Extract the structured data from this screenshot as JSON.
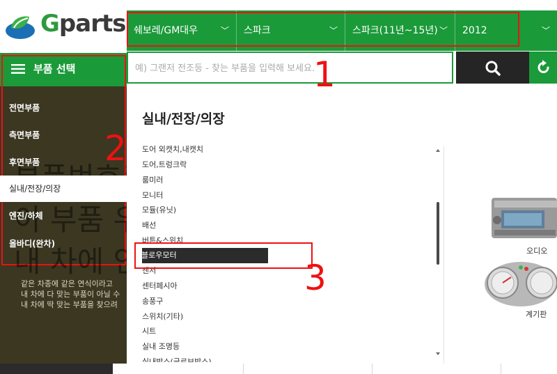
{
  "logo": {
    "brand_g": "G",
    "brand_rest": "parts"
  },
  "vehicle_selector": {
    "maker": "쉐보레/GM대우",
    "model": "스파크",
    "generation": "스파크(11년~15년)",
    "year": "2012"
  },
  "sidebar": {
    "header_label": "부품 선택",
    "categories": [
      {
        "label": "전면부품",
        "active": false
      },
      {
        "label": "측면부품",
        "active": false
      },
      {
        "label": "후면부품",
        "active": false
      },
      {
        "label": "실내/전장/의장",
        "active": true
      },
      {
        "label": "엔진/하체",
        "active": false
      },
      {
        "label": "올바디(완차)",
        "active": false
      }
    ],
    "background_text": [
      "부품번호로 검",
      "이 부품 우",
      "내 차에 안"
    ],
    "description": [
      "같은 차종에 같은 연식이라고",
      "내 차에 다 맞는 부품이 아닐 수",
      "내 차에 딱 맞는 부품을 찾으려"
    ]
  },
  "search": {
    "placeholder": "예) 그랜저 전조등 - 찾는 부품을 입력해 보세요."
  },
  "main": {
    "section_title": "실내/전장/의장",
    "parts": [
      "도어 외캣치,내캣치",
      "도어,트렁크락",
      "룸미러",
      "모니터",
      "모듈(유닛)",
      "배선",
      "버튼&스위치",
      "블로우모터",
      "센서",
      "센터페시아",
      "송풍구",
      "스위치(기타)",
      "시트",
      "실내 조명등",
      "실내박스(글로브박스)"
    ],
    "active_part": "블로우모터",
    "products": [
      {
        "label": "오디오",
        "icon": "car-audio-image"
      },
      {
        "label": "계기판",
        "icon": "instrument-cluster-image"
      }
    ]
  },
  "annotations": [
    "1",
    "2",
    "3"
  ],
  "colors": {
    "brand_green": "#1b9a3a",
    "annotation_red": "#e11111",
    "sidebar_bg": "#3b3721"
  }
}
